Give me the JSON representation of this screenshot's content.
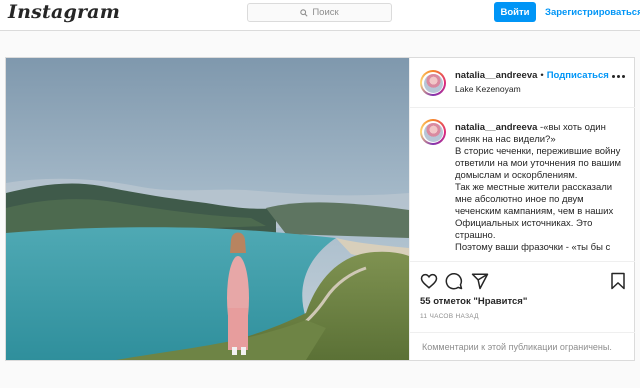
{
  "topbar": {
    "logo": "Instagram",
    "search_placeholder": "Поиск",
    "login_label": "Войти",
    "register_label": "Зарегистрироваться"
  },
  "post": {
    "username": "natalia__andreeva",
    "separator": "•",
    "follow_label": "Подписаться",
    "location": "Lake Kezenoyam",
    "caption_username": "natalia__andreeva",
    "caption_lines": [
      "-«вы хоть один синяк на нас видели?»",
      "В сторис чеченки, пережившие войну ответили на мои уточнения по вашим домыслам и оскорблениям.",
      "Так же местные жители рассказали мне абсолютно иное по двум чеченским кампаниям, чем в наших Официальных источниках. Это страшно.",
      "Поэтому ваши фразочки - «ты бы с"
    ],
    "likes": "55 отметок \"Нравится\"",
    "time_ago": "11 часов назад",
    "comments_disabled": "Комментарии к этой публикации ограничены."
  },
  "icons": [
    "search-icon",
    "more-icon",
    "heart-icon",
    "comment-icon",
    "share-icon",
    "bookmark-icon"
  ],
  "colors": {
    "accent": "#0095f6",
    "border": "#dbdbdb",
    "muted": "#8e8e8e"
  }
}
